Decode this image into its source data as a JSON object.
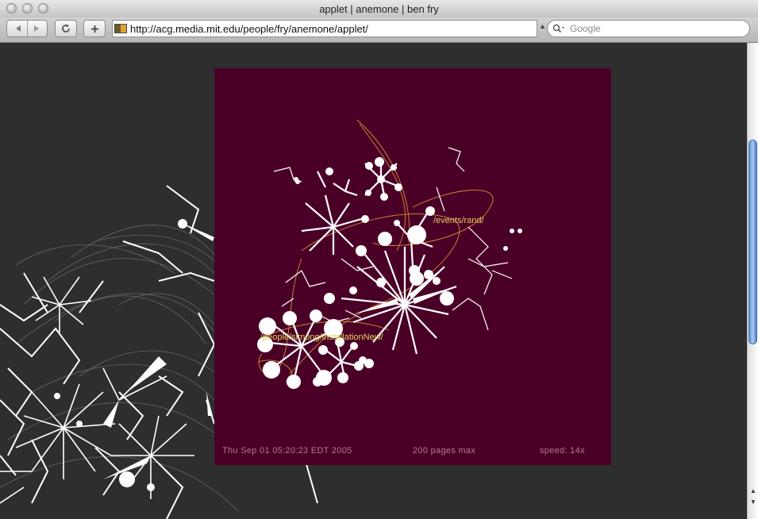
{
  "window": {
    "title": "applet | anemone | ben fry"
  },
  "toolbar": {
    "url": "http://acg.media.mit.edu/people/fry/anemone/applet/",
    "search_placeholder": "Google"
  },
  "applet": {
    "labels": [
      {
        "text": "/events/rand/"
      },
      {
        "text": "/people/simong/installationNew/"
      }
    ],
    "status": {
      "timestamp": "Thu Sep 01 05:20:23 EDT 2005",
      "pages": "200 pages max",
      "speed": "speed: 14x"
    },
    "colors": {
      "background": "#4a0026",
      "branches": "#ffffff",
      "paths": "#d98a35",
      "labels": "#e8cf63",
      "status": "#b07c8e"
    }
  },
  "page": {
    "background": "#2e2e2e"
  }
}
